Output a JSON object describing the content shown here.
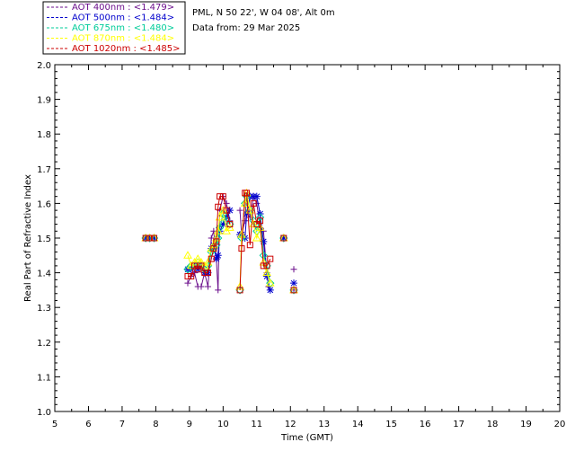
{
  "chart_data": {
    "type": "line",
    "header": {
      "site": "PML, N 50 22', W 04 08', Alt 0m",
      "date": "Data from: 29 Mar 2025"
    },
    "xlabel": "Time (GMT)",
    "ylabel": "Real Part of Refractive Index",
    "xlim": [
      5,
      20
    ],
    "ylim": [
      1.0,
      2.0
    ],
    "x_ticks": [
      "5",
      "6",
      "7",
      "8",
      "9",
      "10",
      "11",
      "12",
      "13",
      "14",
      "15",
      "16",
      "17",
      "18",
      "19",
      "20"
    ],
    "y_ticks": [
      "1.0",
      "1.1",
      "1.2",
      "1.3",
      "1.4",
      "1.5",
      "1.6",
      "1.7",
      "1.8",
      "1.9",
      "2.0"
    ],
    "legend_position": "top-left, outside plot",
    "series": [
      {
        "name": "AOT  400nm : <1.479>",
        "color": "#6b0f8c",
        "marker": "plus",
        "connected": [
          [
            [
              8.95,
              1.37
            ],
            [
              9.05,
              1.39
            ],
            [
              9.15,
              1.4
            ],
            [
              9.25,
              1.36
            ],
            [
              9.35,
              1.36
            ],
            [
              9.45,
              1.4
            ],
            [
              9.55,
              1.36
            ],
            [
              9.65,
              1.5
            ],
            [
              9.72,
              1.52
            ],
            [
              9.8,
              1.44
            ],
            [
              9.85,
              1.35
            ],
            [
              9.9,
              1.58
            ],
            [
              10.0,
              1.62
            ],
            [
              10.1,
              1.6
            ],
            [
              10.2,
              1.55
            ]
          ],
          [
            [
              10.5,
              1.58
            ],
            [
              10.55,
              1.51
            ],
            [
              10.65,
              1.55
            ],
            [
              10.7,
              1.62
            ],
            [
              10.8,
              1.56
            ],
            [
              10.9,
              1.62
            ],
            [
              11.0,
              1.6
            ],
            [
              11.1,
              1.53
            ],
            [
              11.2,
              1.52
            ],
            [
              11.3,
              1.4
            ],
            [
              11.35,
              1.36
            ]
          ]
        ],
        "isolated": [
          [
            7.7,
            1.5
          ],
          [
            7.82,
            1.5
          ],
          [
            7.95,
            1.5
          ],
          [
            11.8,
            1.5
          ],
          [
            12.1,
            1.41
          ],
          [
            12.1,
            1.35
          ]
        ]
      },
      {
        "name": "AOT  500nm : <1.484>",
        "color": "#0000cc",
        "marker": "asterisk",
        "connected": [
          [
            [
              8.95,
              1.41
            ],
            [
              9.05,
              1.41
            ],
            [
              9.15,
              1.42
            ],
            [
              9.25,
              1.41
            ],
            [
              9.35,
              1.42
            ],
            [
              9.45,
              1.4
            ],
            [
              9.55,
              1.4
            ],
            [
              9.65,
              1.47
            ],
            [
              9.72,
              1.48
            ],
            [
              9.8,
              1.44
            ],
            [
              9.85,
              1.45
            ],
            [
              9.9,
              1.52
            ],
            [
              10.0,
              1.54
            ],
            [
              10.1,
              1.56
            ],
            [
              10.2,
              1.58
            ]
          ],
          [
            [
              10.5,
              1.51
            ],
            [
              10.55,
              1.51
            ],
            [
              10.65,
              1.5
            ],
            [
              10.7,
              1.57
            ],
            [
              10.8,
              1.62
            ],
            [
              10.9,
              1.62
            ],
            [
              11.0,
              1.62
            ],
            [
              11.1,
              1.57
            ],
            [
              11.2,
              1.49
            ],
            [
              11.3,
              1.39
            ],
            [
              11.4,
              1.35
            ]
          ]
        ],
        "isolated": [
          [
            7.7,
            1.5
          ],
          [
            7.82,
            1.5
          ],
          [
            7.95,
            1.5
          ],
          [
            11.8,
            1.5
          ],
          [
            12.1,
            1.37
          ]
        ]
      },
      {
        "name": "AOT  675nm : <1.480>",
        "color": "#00cc99",
        "marker": "diamond",
        "connected": [
          [
            [
              8.95,
              1.41
            ],
            [
              9.05,
              1.42
            ],
            [
              9.15,
              1.42
            ],
            [
              9.25,
              1.43
            ],
            [
              9.35,
              1.42
            ],
            [
              9.45,
              1.41
            ],
            [
              9.55,
              1.42
            ],
            [
              9.65,
              1.46
            ],
            [
              9.72,
              1.47
            ],
            [
              9.8,
              1.48
            ],
            [
              9.85,
              1.5
            ],
            [
              9.9,
              1.53
            ],
            [
              10.0,
              1.57
            ],
            [
              10.1,
              1.55
            ],
            [
              10.2,
              1.54
            ]
          ],
          [
            [
              10.5,
              1.35
            ],
            [
              10.55,
              1.5
            ],
            [
              10.65,
              1.6
            ],
            [
              10.7,
              1.62
            ],
            [
              10.8,
              1.58
            ],
            [
              10.9,
              1.55
            ],
            [
              11.0,
              1.52
            ],
            [
              11.1,
              1.56
            ],
            [
              11.2,
              1.45
            ],
            [
              11.3,
              1.42
            ],
            [
              11.4,
              1.37
            ]
          ]
        ],
        "isolated": [
          [
            7.7,
            1.5
          ],
          [
            7.82,
            1.5
          ],
          [
            7.95,
            1.5
          ],
          [
            11.8,
            1.5
          ],
          [
            12.1,
            1.35
          ]
        ]
      },
      {
        "name": "AOT  870nm : <1.484>",
        "color": "#ffff00",
        "marker": "triangle",
        "connected": [
          [
            [
              8.95,
              1.45
            ],
            [
              9.05,
              1.42
            ],
            [
              9.15,
              1.43
            ],
            [
              9.25,
              1.44
            ],
            [
              9.35,
              1.43
            ],
            [
              9.45,
              1.42
            ],
            [
              9.55,
              1.43
            ],
            [
              9.65,
              1.47
            ],
            [
              9.72,
              1.48
            ],
            [
              9.8,
              1.5
            ],
            [
              9.85,
              1.52
            ],
            [
              9.9,
              1.56
            ],
            [
              10.0,
              1.58
            ],
            [
              10.1,
              1.52
            ],
            [
              10.2,
              1.53
            ]
          ],
          [
            [
              10.5,
              1.36
            ],
            [
              10.55,
              1.51
            ],
            [
              10.65,
              1.6
            ],
            [
              10.7,
              1.63
            ],
            [
              10.8,
              1.58
            ],
            [
              10.9,
              1.54
            ],
            [
              11.0,
              1.5
            ],
            [
              11.1,
              1.53
            ],
            [
              11.2,
              1.43
            ],
            [
              11.3,
              1.4
            ],
            [
              11.4,
              1.37
            ]
          ]
        ],
        "isolated": [
          [
            7.7,
            1.5
          ],
          [
            7.82,
            1.5
          ],
          [
            7.95,
            1.5
          ],
          [
            11.8,
            1.5
          ],
          [
            12.1,
            1.35
          ]
        ]
      },
      {
        "name": "AOT 1020nm : <1.485>",
        "color": "#cc0000",
        "marker": "square",
        "connected": [
          [
            [
              8.95,
              1.39
            ],
            [
              9.05,
              1.39
            ],
            [
              9.15,
              1.42
            ],
            [
              9.25,
              1.41
            ],
            [
              9.35,
              1.42
            ],
            [
              9.45,
              1.4
            ],
            [
              9.55,
              1.4
            ],
            [
              9.65,
              1.44
            ],
            [
              9.72,
              1.47
            ],
            [
              9.8,
              1.49
            ],
            [
              9.85,
              1.59
            ],
            [
              9.9,
              1.62
            ],
            [
              10.0,
              1.62
            ],
            [
              10.1,
              1.58
            ],
            [
              10.2,
              1.54
            ]
          ],
          [
            [
              10.5,
              1.35
            ],
            [
              10.55,
              1.47
            ],
            [
              10.65,
              1.63
            ],
            [
              10.7,
              1.63
            ],
            [
              10.8,
              1.48
            ],
            [
              10.9,
              1.6
            ],
            [
              11.0,
              1.54
            ],
            [
              11.1,
              1.55
            ],
            [
              11.2,
              1.42
            ],
            [
              11.3,
              1.42
            ],
            [
              11.4,
              1.44
            ]
          ]
        ],
        "isolated": [
          [
            7.7,
            1.5
          ],
          [
            7.82,
            1.5
          ],
          [
            7.95,
            1.5
          ],
          [
            11.8,
            1.5
          ],
          [
            12.1,
            1.35
          ]
        ]
      }
    ]
  }
}
